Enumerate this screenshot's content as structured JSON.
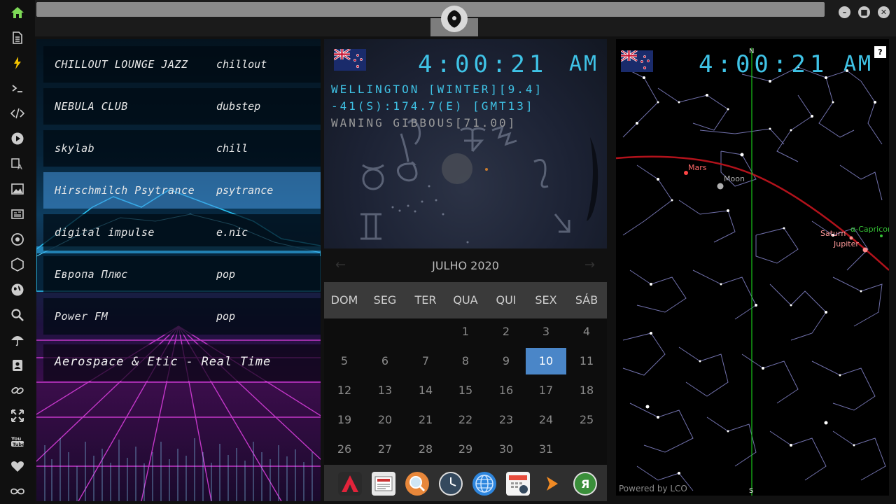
{
  "sidebar": {
    "items": [
      {
        "icon": "home-icon",
        "color": "#7ed957"
      },
      {
        "icon": "document-icon",
        "color": "#cccccc"
      },
      {
        "icon": "lightning-icon",
        "color": "#f2c200"
      },
      {
        "icon": "terminal-icon",
        "color": "#cccccc"
      },
      {
        "icon": "code-icon",
        "color": "#cccccc"
      },
      {
        "icon": "play-icon",
        "color": "#cccccc"
      },
      {
        "icon": "translate-icon",
        "color": "#cccccc"
      },
      {
        "icon": "image-icon",
        "color": "#cccccc"
      },
      {
        "icon": "news-icon",
        "color": "#cccccc"
      },
      {
        "icon": "rebel-icon",
        "color": "#cccccc"
      },
      {
        "icon": "hexagon-icon",
        "color": "#cccccc"
      },
      {
        "icon": "globe-icon",
        "color": "#cccccc"
      },
      {
        "icon": "search-icon",
        "color": "#cccccc"
      },
      {
        "icon": "umbrella-icon",
        "color": "#cccccc"
      },
      {
        "icon": "contact-icon",
        "color": "#cccccc"
      },
      {
        "icon": "link-icon",
        "color": "#cccccc"
      },
      {
        "icon": "expand-icon",
        "color": "#cccccc"
      },
      {
        "icon": "youtube-icon",
        "color": "#cccccc"
      },
      {
        "icon": "heart-icon",
        "color": "#cccccc"
      },
      {
        "icon": "infinity-icon",
        "color": "#cccccc"
      }
    ]
  },
  "radio": {
    "stations": [
      {
        "name": "CHILLOUT LOUNGE JAZZ",
        "genre": "chillout"
      },
      {
        "name": "NEBULA CLUB",
        "genre": "dubstep"
      },
      {
        "name": "skylab",
        "genre": "chill"
      },
      {
        "name": "Hirschmilch Psytrance",
        "genre": "psytrance",
        "active": true
      },
      {
        "name": "digital impulse",
        "genre": "e.nic"
      },
      {
        "name": "Европа Плюс",
        "genre": "pop"
      },
      {
        "name": "Power FM",
        "genre": "pop"
      }
    ],
    "now_playing": "Aerospace & Etic - Real Time"
  },
  "clock": {
    "time": "4:00:21",
    "ampm": "AM",
    "location": "WELLINGTON [WINTER][9.4]",
    "coords": "-41(S):174.7(E) [GMT13]",
    "moon": "WANING GIBBOUS[71.00]"
  },
  "calendar": {
    "title": "JULHO 2020",
    "days": [
      "DOM",
      "SEG",
      "TER",
      "QUA",
      "QUI",
      "SEX",
      "SÁB"
    ],
    "weeks": [
      [
        "",
        "",
        "",
        "1",
        "2",
        "3",
        "4"
      ],
      [
        "5",
        "6",
        "7",
        "8",
        "9",
        "10",
        "11"
      ],
      [
        "12",
        "13",
        "14",
        "15",
        "16",
        "17",
        "18"
      ],
      [
        "19",
        "20",
        "21",
        "22",
        "23",
        "24",
        "25"
      ],
      [
        "26",
        "27",
        "28",
        "29",
        "30",
        "31",
        ""
      ]
    ],
    "today": "10"
  },
  "sky": {
    "time": "4:00:21",
    "ampm": "AM",
    "north": "N",
    "south": "S",
    "labels": {
      "mars": "Mars",
      "moon": "Moon",
      "saturn": "Saturn",
      "jupiter": "Jupiter",
      "capricorn": "α-Capricor"
    },
    "credit": "Powered by LCO",
    "help": "?"
  },
  "window": {
    "minimize": "–",
    "maximize": "■",
    "close": "✕"
  }
}
